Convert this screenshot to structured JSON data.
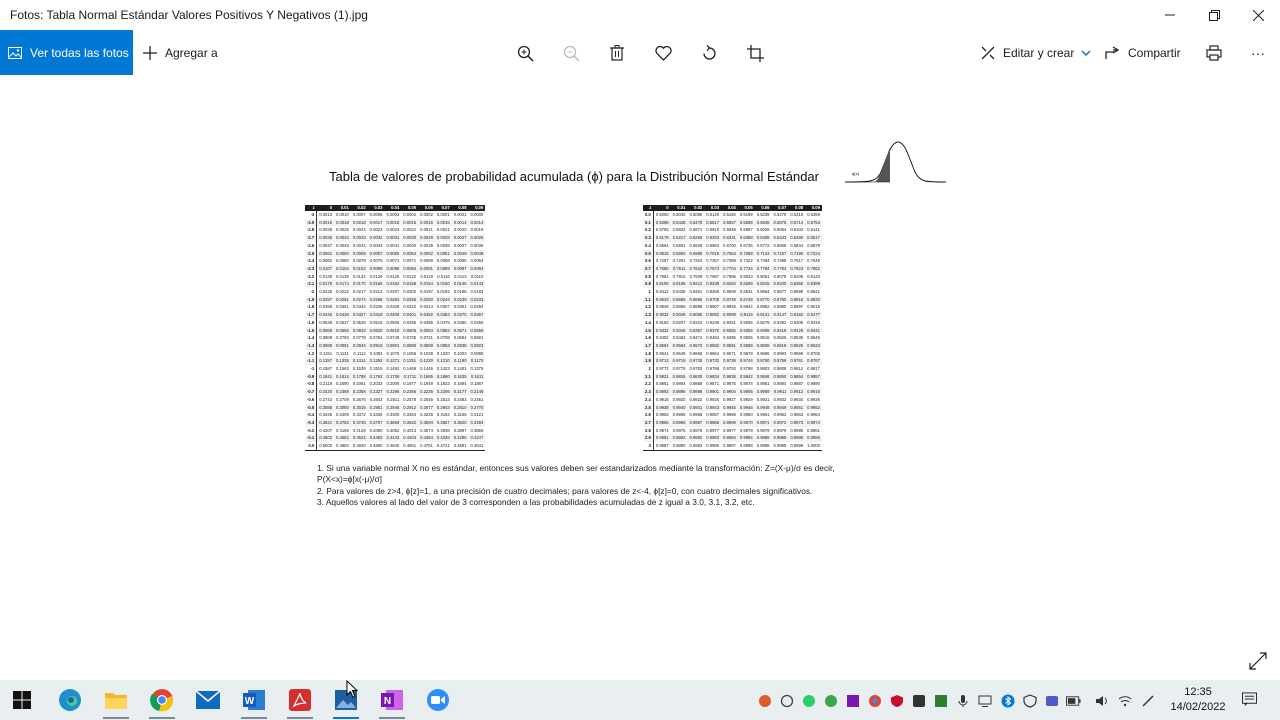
{
  "window": {
    "title": "Fotos: Tabla Normal Estándar Valores Positivos Y Negativos (1).jpg",
    "minimize": "—",
    "maximize": "❐",
    "close": "✕"
  },
  "toolbar": {
    "view_all": "Ver todas las fotos",
    "add_to": "Agregar a",
    "edit_create": "Editar y crear",
    "share": "Compartir",
    "more": "···",
    "accent": "#0078d4"
  },
  "photo": {
    "title": "Tabla de valores de probabilidad acumulada (ϕ) para la Distribución Normal Estándar",
    "bell_label": "ϕ(z)",
    "header": [
      "z",
      "0",
      "0.01",
      "0.02",
      "0.03",
      "0.04",
      "0.05",
      "0.06",
      "0.07",
      "0.08",
      "0.09"
    ],
    "neg_rows": [
      [
        "-3",
        "0.0013",
        "0.0010",
        "0.0007",
        "0.0005",
        "0.0003",
        "0.0002",
        "0.0002",
        "0.0001",
        "0.0001",
        "0.0000"
      ],
      [
        "-2.9",
        "0.0019",
        "0.0018",
        "0.0018",
        "0.0017",
        "0.0016",
        "0.0016",
        "0.0015",
        "0.0015",
        "0.0014",
        "0.0014"
      ],
      [
        "-2.8",
        "0.0026",
        "0.0025",
        "0.0024",
        "0.0023",
        "0.0023",
        "0.0022",
        "0.0021",
        "0.0021",
        "0.0020",
        "0.0019"
      ],
      [
        "-2.7",
        "0.0035",
        "0.0034",
        "0.0033",
        "0.0032",
        "0.0031",
        "0.0030",
        "0.0029",
        "0.0028",
        "0.0027",
        "0.0026"
      ],
      [
        "-2.6",
        "0.0047",
        "0.0045",
        "0.0044",
        "0.0043",
        "0.0041",
        "0.0040",
        "0.0039",
        "0.0038",
        "0.0037",
        "0.0036"
      ],
      [
        "-2.5",
        "0.0062",
        "0.0060",
        "0.0059",
        "0.0057",
        "0.0055",
        "0.0054",
        "0.0052",
        "0.0051",
        "0.0049",
        "0.0048"
      ],
      [
        "-2.4",
        "0.0082",
        "0.0080",
        "0.0078",
        "0.0075",
        "0.0073",
        "0.0071",
        "0.0069",
        "0.0068",
        "0.0066",
        "0.0064"
      ],
      [
        "-2.3",
        "0.0107",
        "0.0104",
        "0.0102",
        "0.0099",
        "0.0096",
        "0.0094",
        "0.0091",
        "0.0089",
        "0.0087",
        "0.0084"
      ],
      [
        "-2.2",
        "0.0139",
        "0.0136",
        "0.0132",
        "0.0129",
        "0.0125",
        "0.0122",
        "0.0119",
        "0.0116",
        "0.0113",
        "0.0110"
      ],
      [
        "-2.1",
        "0.0179",
        "0.0174",
        "0.0170",
        "0.0166",
        "0.0162",
        "0.0158",
        "0.0154",
        "0.0150",
        "0.0146",
        "0.0143"
      ],
      [
        "-2",
        "0.0228",
        "0.0222",
        "0.0217",
        "0.0212",
        "0.0207",
        "0.0202",
        "0.0197",
        "0.0192",
        "0.0188",
        "0.0183"
      ],
      [
        "-1.9",
        "0.0287",
        "0.0281",
        "0.0274",
        "0.0268",
        "0.0262",
        "0.0256",
        "0.0250",
        "0.0244",
        "0.0239",
        "0.0233"
      ],
      [
        "-1.8",
        "0.0359",
        "0.0351",
        "0.0344",
        "0.0336",
        "0.0329",
        "0.0322",
        "0.0314",
        "0.0307",
        "0.0301",
        "0.0294"
      ],
      [
        "-1.7",
        "0.0446",
        "0.0436",
        "0.0427",
        "0.0418",
        "0.0409",
        "0.0401",
        "0.0392",
        "0.0384",
        "0.0375",
        "0.0367"
      ],
      [
        "-1.6",
        "0.0548",
        "0.0537",
        "0.0526",
        "0.0516",
        "0.0505",
        "0.0495",
        "0.0485",
        "0.0475",
        "0.0465",
        "0.0455"
      ],
      [
        "-1.5",
        "0.0668",
        "0.0655",
        "0.0643",
        "0.0630",
        "0.0618",
        "0.0606",
        "0.0594",
        "0.0582",
        "0.0571",
        "0.0559"
      ],
      [
        "-1.4",
        "0.0808",
        "0.0793",
        "0.0778",
        "0.0764",
        "0.0749",
        "0.0735",
        "0.0721",
        "0.0708",
        "0.0694",
        "0.0681"
      ],
      [
        "-1.3",
        "0.0968",
        "0.0951",
        "0.0934",
        "0.0918",
        "0.0901",
        "0.0885",
        "0.0869",
        "0.0853",
        "0.0838",
        "0.0823"
      ],
      [
        "-1.2",
        "0.1151",
        "0.1131",
        "0.1112",
        "0.1093",
        "0.1075",
        "0.1056",
        "0.1038",
        "0.1020",
        "0.1003",
        "0.0985"
      ],
      [
        "-1.1",
        "0.1357",
        "0.1335",
        "0.1314",
        "0.1292",
        "0.1271",
        "0.1251",
        "0.1230",
        "0.1210",
        "0.1190",
        "0.1170"
      ],
      [
        "-1",
        "0.1587",
        "0.1562",
        "0.1539",
        "0.1515",
        "0.1492",
        "0.1469",
        "0.1446",
        "0.1423",
        "0.1401",
        "0.1379"
      ],
      [
        "-0.9",
        "0.1841",
        "0.1814",
        "0.1788",
        "0.1762",
        "0.1736",
        "0.1711",
        "0.1685",
        "0.1660",
        "0.1635",
        "0.1611"
      ],
      [
        "-0.8",
        "0.2119",
        "0.2090",
        "0.2061",
        "0.2033",
        "0.2005",
        "0.1977",
        "0.1949",
        "0.1922",
        "0.1894",
        "0.1867"
      ],
      [
        "-0.7",
        "0.2420",
        "0.2389",
        "0.2358",
        "0.2327",
        "0.2296",
        "0.2266",
        "0.2236",
        "0.2206",
        "0.2177",
        "0.2148"
      ],
      [
        "-0.6",
        "0.2743",
        "0.2709",
        "0.2676",
        "0.2643",
        "0.2611",
        "0.2578",
        "0.2546",
        "0.2514",
        "0.2483",
        "0.2451"
      ],
      [
        "-0.5",
        "0.3085",
        "0.3050",
        "0.3015",
        "0.2981",
        "0.2946",
        "0.2912",
        "0.2877",
        "0.2843",
        "0.2810",
        "0.2776"
      ],
      [
        "-0.4",
        "0.3446",
        "0.3409",
        "0.3372",
        "0.3336",
        "0.3300",
        "0.3264",
        "0.3228",
        "0.3192",
        "0.3156",
        "0.3121"
      ],
      [
        "-0.3",
        "0.3821",
        "0.3783",
        "0.3745",
        "0.3707",
        "0.3669",
        "0.3632",
        "0.3594",
        "0.3557",
        "0.3520",
        "0.3483"
      ],
      [
        "-0.2",
        "0.4207",
        "0.4168",
        "0.4129",
        "0.4090",
        "0.4052",
        "0.4013",
        "0.3974",
        "0.3936",
        "0.3897",
        "0.3859"
      ],
      [
        "-0.1",
        "0.4602",
        "0.4562",
        "0.4522",
        "0.4483",
        "0.4443",
        "0.4404",
        "0.4364",
        "0.4325",
        "0.4286",
        "0.4247"
      ],
      [
        "0.0",
        "0.5000",
        "0.4960",
        "0.4920",
        "0.4880",
        "0.4840",
        "0.4801",
        "0.4761",
        "0.4721",
        "0.4681",
        "0.4641"
      ]
    ],
    "pos_rows": [
      [
        "0.0",
        "0.5000",
        "0.5040",
        "0.5080",
        "0.5120",
        "0.5160",
        "0.5199",
        "0.5239",
        "0.5279",
        "0.5319",
        "0.5359"
      ],
      [
        "0.1",
        "0.5398",
        "0.5438",
        "0.5478",
        "0.5517",
        "0.5557",
        "0.5596",
        "0.5636",
        "0.5675",
        "0.5714",
        "0.5753"
      ],
      [
        "0.2",
        "0.5793",
        "0.5832",
        "0.5871",
        "0.5910",
        "0.5948",
        "0.5987",
        "0.6026",
        "0.6064",
        "0.6103",
        "0.6141"
      ],
      [
        "0.3",
        "0.6179",
        "0.6217",
        "0.6255",
        "0.6293",
        "0.6331",
        "0.6368",
        "0.6406",
        "0.6443",
        "0.6480",
        "0.6517"
      ],
      [
        "0.4",
        "0.6554",
        "0.6591",
        "0.6628",
        "0.6664",
        "0.6700",
        "0.6736",
        "0.6772",
        "0.6808",
        "0.6844",
        "0.6879"
      ],
      [
        "0.5",
        "0.6915",
        "0.6950",
        "0.6985",
        "0.7019",
        "0.7054",
        "0.7088",
        "0.7123",
        "0.7157",
        "0.7190",
        "0.7224"
      ],
      [
        "0.6",
        "0.7257",
        "0.7291",
        "0.7324",
        "0.7357",
        "0.7389",
        "0.7422",
        "0.7454",
        "0.7486",
        "0.7517",
        "0.7549"
      ],
      [
        "0.7",
        "0.7580",
        "0.7611",
        "0.7642",
        "0.7673",
        "0.7704",
        "0.7734",
        "0.7764",
        "0.7794",
        "0.7823",
        "0.7852"
      ],
      [
        "0.8",
        "0.7881",
        "0.7910",
        "0.7939",
        "0.7967",
        "0.7995",
        "0.8023",
        "0.8051",
        "0.8078",
        "0.8106",
        "0.8133"
      ],
      [
        "0.9",
        "0.8159",
        "0.8186",
        "0.8212",
        "0.8238",
        "0.8264",
        "0.8289",
        "0.8315",
        "0.8340",
        "0.8365",
        "0.8389"
      ],
      [
        "1",
        "0.8413",
        "0.8438",
        "0.8461",
        "0.8485",
        "0.8508",
        "0.8531",
        "0.8554",
        "0.8577",
        "0.8599",
        "0.8621"
      ],
      [
        "1.1",
        "0.8643",
        "0.8665",
        "0.8686",
        "0.8708",
        "0.8729",
        "0.8749",
        "0.8770",
        "0.8790",
        "0.8810",
        "0.8830"
      ],
      [
        "1.2",
        "0.8849",
        "0.8869",
        "0.8888",
        "0.8907",
        "0.8925",
        "0.8944",
        "0.8962",
        "0.8980",
        "0.8997",
        "0.9015"
      ],
      [
        "1.3",
        "0.9032",
        "0.9049",
        "0.9066",
        "0.9082",
        "0.9099",
        "0.9115",
        "0.9131",
        "0.9147",
        "0.9162",
        "0.9177"
      ],
      [
        "1.4",
        "0.9192",
        "0.9207",
        "0.9222",
        "0.9236",
        "0.9251",
        "0.9265",
        "0.9279",
        "0.9292",
        "0.9306",
        "0.9319"
      ],
      [
        "1.5",
        "0.9332",
        "0.9345",
        "0.9357",
        "0.9370",
        "0.9382",
        "0.9394",
        "0.9406",
        "0.9418",
        "0.9429",
        "0.9441"
      ],
      [
        "1.6",
        "0.9452",
        "0.9463",
        "0.9474",
        "0.9484",
        "0.9495",
        "0.9505",
        "0.9515",
        "0.9525",
        "0.9535",
        "0.9545"
      ],
      [
        "1.7",
        "0.9554",
        "0.9564",
        "0.9573",
        "0.9582",
        "0.9591",
        "0.9599",
        "0.9608",
        "0.9616",
        "0.9625",
        "0.9633"
      ],
      [
        "1.8",
        "0.9641",
        "0.9649",
        "0.9656",
        "0.9664",
        "0.9671",
        "0.9678",
        "0.9686",
        "0.9693",
        "0.9699",
        "0.9706"
      ],
      [
        "1.9",
        "0.9713",
        "0.9719",
        "0.9726",
        "0.9732",
        "0.9738",
        "0.9744",
        "0.9750",
        "0.9756",
        "0.9761",
        "0.9767"
      ],
      [
        "2",
        "0.9772",
        "0.9778",
        "0.9783",
        "0.9788",
        "0.9793",
        "0.9798",
        "0.9803",
        "0.9808",
        "0.9812",
        "0.9817"
      ],
      [
        "2.1",
        "0.9821",
        "0.9826",
        "0.9830",
        "0.9834",
        "0.9838",
        "0.9842",
        "0.9846",
        "0.9850",
        "0.9854",
        "0.9857"
      ],
      [
        "2.2",
        "0.9861",
        "0.9864",
        "0.9868",
        "0.9871",
        "0.9875",
        "0.9878",
        "0.9881",
        "0.9884",
        "0.9887",
        "0.9890"
      ],
      [
        "2.3",
        "0.9893",
        "0.9896",
        "0.9898",
        "0.9901",
        "0.9904",
        "0.9906",
        "0.9909",
        "0.9911",
        "0.9913",
        "0.9916"
      ],
      [
        "2.4",
        "0.9918",
        "0.9920",
        "0.9922",
        "0.9925",
        "0.9927",
        "0.9929",
        "0.9931",
        "0.9932",
        "0.9934",
        "0.9936"
      ],
      [
        "2.5",
        "0.9938",
        "0.9940",
        "0.9941",
        "0.9943",
        "0.9945",
        "0.9946",
        "0.9948",
        "0.9949",
        "0.9951",
        "0.9952"
      ],
      [
        "2.6",
        "0.9953",
        "0.9955",
        "0.9956",
        "0.9957",
        "0.9959",
        "0.9960",
        "0.9961",
        "0.9962",
        "0.9963",
        "0.9964"
      ],
      [
        "2.7",
        "0.9965",
        "0.9966",
        "0.9967",
        "0.9968",
        "0.9969",
        "0.9970",
        "0.9971",
        "0.9972",
        "0.9973",
        "0.9974"
      ],
      [
        "2.8",
        "0.9974",
        "0.9975",
        "0.9976",
        "0.9977",
        "0.9977",
        "0.9978",
        "0.9979",
        "0.9979",
        "0.9980",
        "0.9981"
      ],
      [
        "2.9",
        "0.9981",
        "0.9982",
        "0.9982",
        "0.9983",
        "0.9984",
        "0.9984",
        "0.9985",
        "0.9985",
        "0.9986",
        "0.9986"
      ],
      [
        "3",
        "0.9987",
        "0.9990",
        "0.9993",
        "0.9995",
        "0.9997",
        "0.9998",
        "0.9998",
        "0.9999",
        "0.9999",
        "1.0000"
      ]
    ],
    "notes": [
      "1. Si una variable normal X no es estándar, entonces sus valores deben ser estandarizados mediante la transformación: Z=(X-μ)/σ es decir,",
      "P(X<x)=ϕ[x(-μ)/σ]",
      "2. Para valores de z>4, ϕ[z]=1, a una precisión de cuatro decimales; para valores de z<-4, ϕ[z]=0, con cuatro decimales significativos.",
      "3. Aquellos valores al lado del valor de 3 corresponden a las probabilidades acumuladas de z igual a 3.0, 3.1, 3.2, etc."
    ]
  },
  "taskbar": {
    "icons": [
      "windows-start-icon",
      "edge-icon",
      "file-explorer-icon",
      "chrome-icon",
      "mail-icon",
      "word-icon",
      "acrobat-icon",
      "photos-icon",
      "onenote-icon",
      "zoom-icon"
    ],
    "time": "12:35",
    "date": "14/02/2022"
  }
}
